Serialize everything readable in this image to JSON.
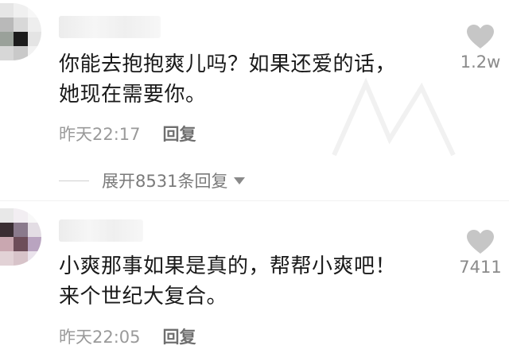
{
  "comments": [
    {
      "text_lines": [
        "你能去抱抱爽儿吗？如果还爱的话，",
        "她现在需要你。"
      ],
      "time": "昨天22:17",
      "reply_label": "回复",
      "like_count": "1.2w",
      "expand_label": "展开8531条回复"
    },
    {
      "text_lines": [
        "小爽那事如果是真的，帮帮小爽吧！",
        "来个世纪大复合。"
      ],
      "time": "昨天22:05",
      "reply_label": "回复",
      "like_count": "7411"
    }
  ],
  "icons": {
    "like": "heart-icon",
    "expand": "caret-down-icon"
  },
  "colors": {
    "text": "#1a1a1a",
    "meta": "#9a9a9a",
    "reply": "#6f6f6f",
    "heart": "#c6c6c6"
  }
}
